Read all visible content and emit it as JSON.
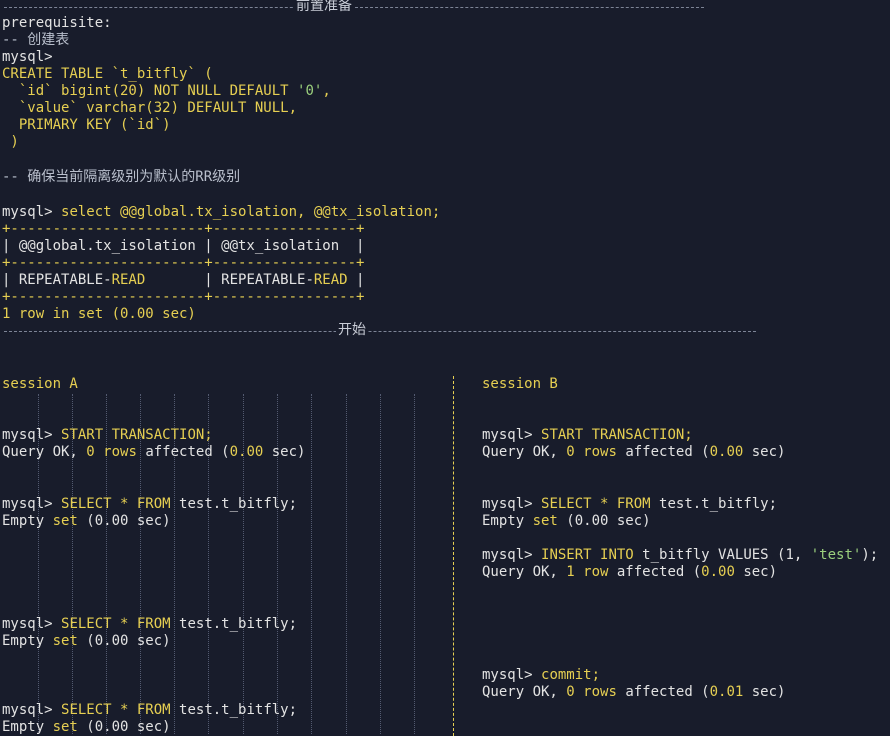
{
  "header_sep_label": "前置准备",
  "start_sep_label": "开始",
  "prereq": {
    "title": "prerequisite:",
    "comment_create": "-- 创建表",
    "prompt": "mysql>",
    "create_1a": "CREATE TABLE `t_bitfly` (",
    "create_2_col": "  `id` bigint(20) NOT NULL DEFAULT ",
    "create_2_val": "'0'",
    "create_2_end": ",",
    "create_3": "  `value` varchar(32) DEFAULT NULL,",
    "create_4": "  PRIMARY KEY (`id`)",
    "create_5": " )",
    "comment_rr": "-- 确保当前隔离级别为默认的RR级别",
    "select_prompt": "mysql> ",
    "select_iso": "select @@global.tx_isolation, @@tx_isolation;",
    "tbl_border": "+-----------------------+-----------------+",
    "tbl_header": "| @@global.tx_isolation | @@tx_isolation  |",
    "tbl_row_a": "| REPEATABLE-",
    "tbl_row_b": "READ",
    "tbl_row_c": "       | REPEATABLE-",
    "tbl_row_d": "READ",
    "tbl_row_e": " |",
    "row_count": "1 row in set (0.00 sec)"
  },
  "session_a": {
    "label": "session A",
    "prompt": "mysql> ",
    "start_tx": "START TRANSACTION;",
    "query_ok_a": "Query OK, ",
    "zero": "0",
    "rows_affected": " rows affected (",
    "time_000": "0.00",
    "sec_close": " sec)",
    "select_kw": "SELECT * FROM ",
    "select_tbl": "test.t_bitfly;",
    "empty_a": "Empty ",
    "empty_set": "set",
    "empty_b": " (0.00 sec)"
  },
  "session_b": {
    "label": "session B",
    "prompt": "mysql> ",
    "start_tx": "START TRANSACTION;",
    "query_ok_a": "Query OK, ",
    "zero": "0",
    "rows_affected": " rows affected (",
    "time_000": "0.00",
    "sec_close": " sec)",
    "select_kw": "SELECT * FROM ",
    "select_tbl": "test.t_bitfly;",
    "empty_a": "Empty ",
    "empty_set": "set",
    "empty_b": " (0.00 sec)",
    "insert_kw": "INSERT INTO ",
    "insert_tbl": "t_bitfly VALUES (1, ",
    "insert_val": "'test'",
    "insert_end": ");",
    "one": "1",
    "row_affected": " row affected (",
    "commit": "commit;",
    "time_001": "0.01"
  }
}
